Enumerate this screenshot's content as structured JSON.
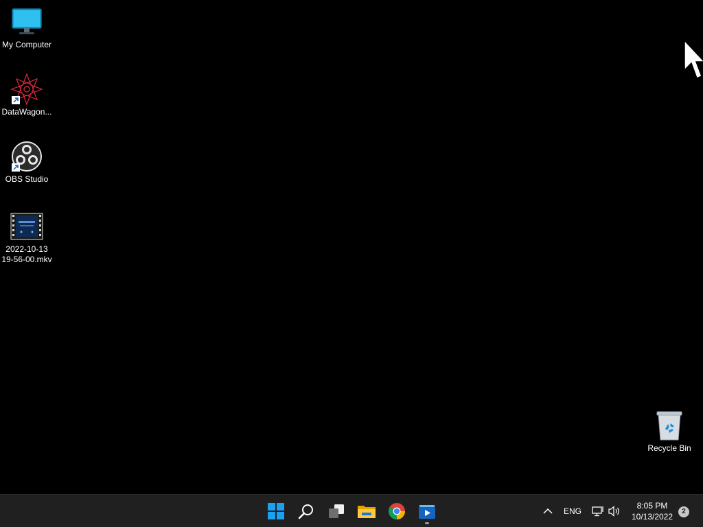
{
  "desktop": {
    "icons": [
      {
        "label": "My Computer",
        "icon": "monitor-icon"
      },
      {
        "label": "DataWagon...",
        "icon": "datawagon-icon",
        "shortcut": true
      },
      {
        "label": "OBS Studio",
        "icon": "obs-icon",
        "shortcut": true
      },
      {
        "label": "2022-10-13\n19-56-00.mkv",
        "icon": "video-file-icon"
      },
      {
        "label": "Recycle Bin",
        "icon": "recycle-bin-icon"
      }
    ]
  },
  "taskbar": {
    "apps": [
      {
        "name": "Start",
        "icon": "windows-start-icon"
      },
      {
        "name": "Search",
        "icon": "search-icon"
      },
      {
        "name": "Task View",
        "icon": "task-view-icon"
      },
      {
        "name": "File Explorer",
        "icon": "folder-icon"
      },
      {
        "name": "Google Chrome",
        "icon": "chrome-icon"
      },
      {
        "name": "Media Player",
        "icon": "media-player-icon",
        "running": true
      }
    ],
    "tray": {
      "language": "ENG",
      "time": "8:05 PM",
      "date": "10/13/2022",
      "notification_count": "2"
    }
  },
  "colors": {
    "desktop_bg": "#000000",
    "taskbar_bg": "#202020",
    "accent_blue": "#0a84d6"
  }
}
